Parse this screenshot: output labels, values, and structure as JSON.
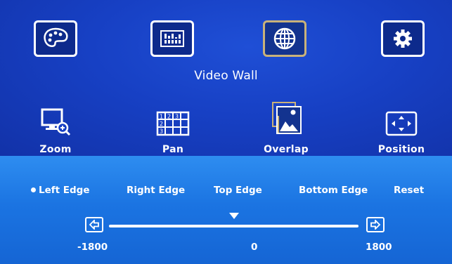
{
  "main_menu": {
    "items": [
      {
        "icon": "palette-icon"
      },
      {
        "icon": "input-settings-icon"
      },
      {
        "icon": "globe-icon",
        "selected": true
      },
      {
        "icon": "gear-icon"
      }
    ],
    "selected_title": "Video Wall"
  },
  "submenu": {
    "items": [
      {
        "label": "Zoom",
        "icon": "zoom-monitor-icon"
      },
      {
        "label": "Pan",
        "icon": "grid-pan-icon"
      },
      {
        "label": "Overlap",
        "icon": "overlap-picture-icon"
      },
      {
        "label": "Position",
        "icon": "position-arrows-icon"
      }
    ]
  },
  "overlap_options": {
    "items": [
      {
        "label": "Left Edge",
        "selected": true
      },
      {
        "label": "Right Edge"
      },
      {
        "label": "Top Edge"
      },
      {
        "label": "Bottom Edge"
      },
      {
        "label": "Reset"
      }
    ]
  },
  "slider": {
    "min_label": "-1800",
    "max_label": "1800",
    "value_label": "0",
    "min": -1800,
    "max": 1800,
    "value": 0
  },
  "colors": {
    "top_panel": "#1740c4",
    "bottom_panel": "#1b74e2",
    "selected_border": "#c9b27a"
  }
}
